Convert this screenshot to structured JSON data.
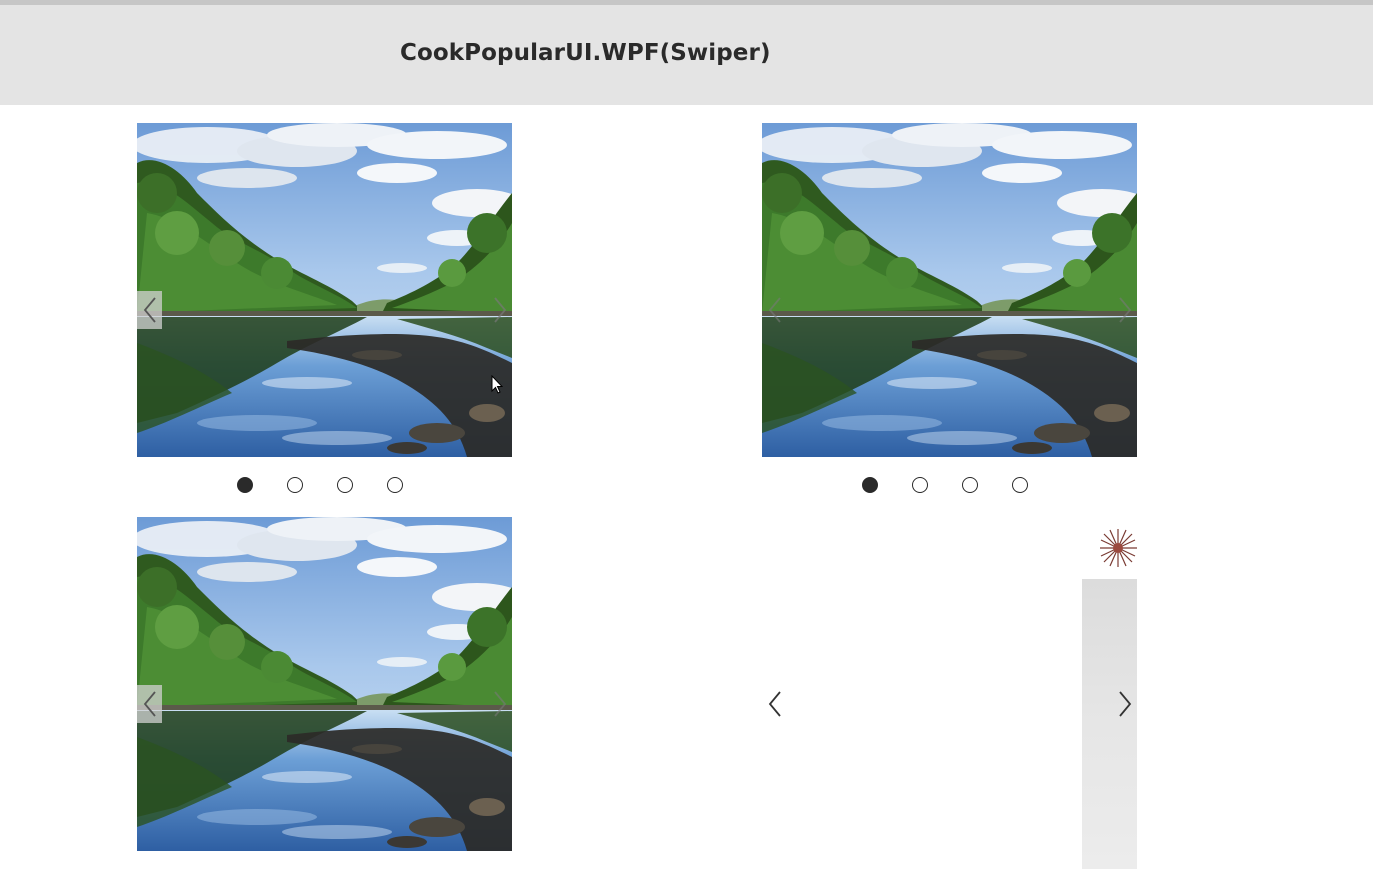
{
  "app": {
    "title": "CookPopularUI.WPF(Swiper)"
  },
  "swipers": [
    {
      "image": "river-landscape-photo",
      "prev_icon": "chevron-left-icon",
      "next_icon": "chevron-right-icon",
      "slide_count": 4,
      "active_index": 0,
      "show_indicator": true
    },
    {
      "image": "river-landscape-photo",
      "prev_icon": "chevron-left-icon",
      "next_icon": "chevron-right-icon",
      "slide_count": 4,
      "active_index": 0,
      "show_indicator": true
    },
    {
      "image": "river-landscape-photo",
      "prev_icon": "chevron-left-icon",
      "next_icon": "chevron-right-icon",
      "show_indicator": false
    },
    {
      "image": "flower-photo-partial",
      "prev_icon": "chevron-left-icon",
      "next_icon": "chevron-right-icon",
      "show_indicator": false
    }
  ],
  "colors": {
    "header_bg": "#e4e4e4",
    "title_text": "#2a2a2a",
    "dot_active": "#2a2a2a",
    "dot_inactive_border": "#2a2a2a"
  }
}
